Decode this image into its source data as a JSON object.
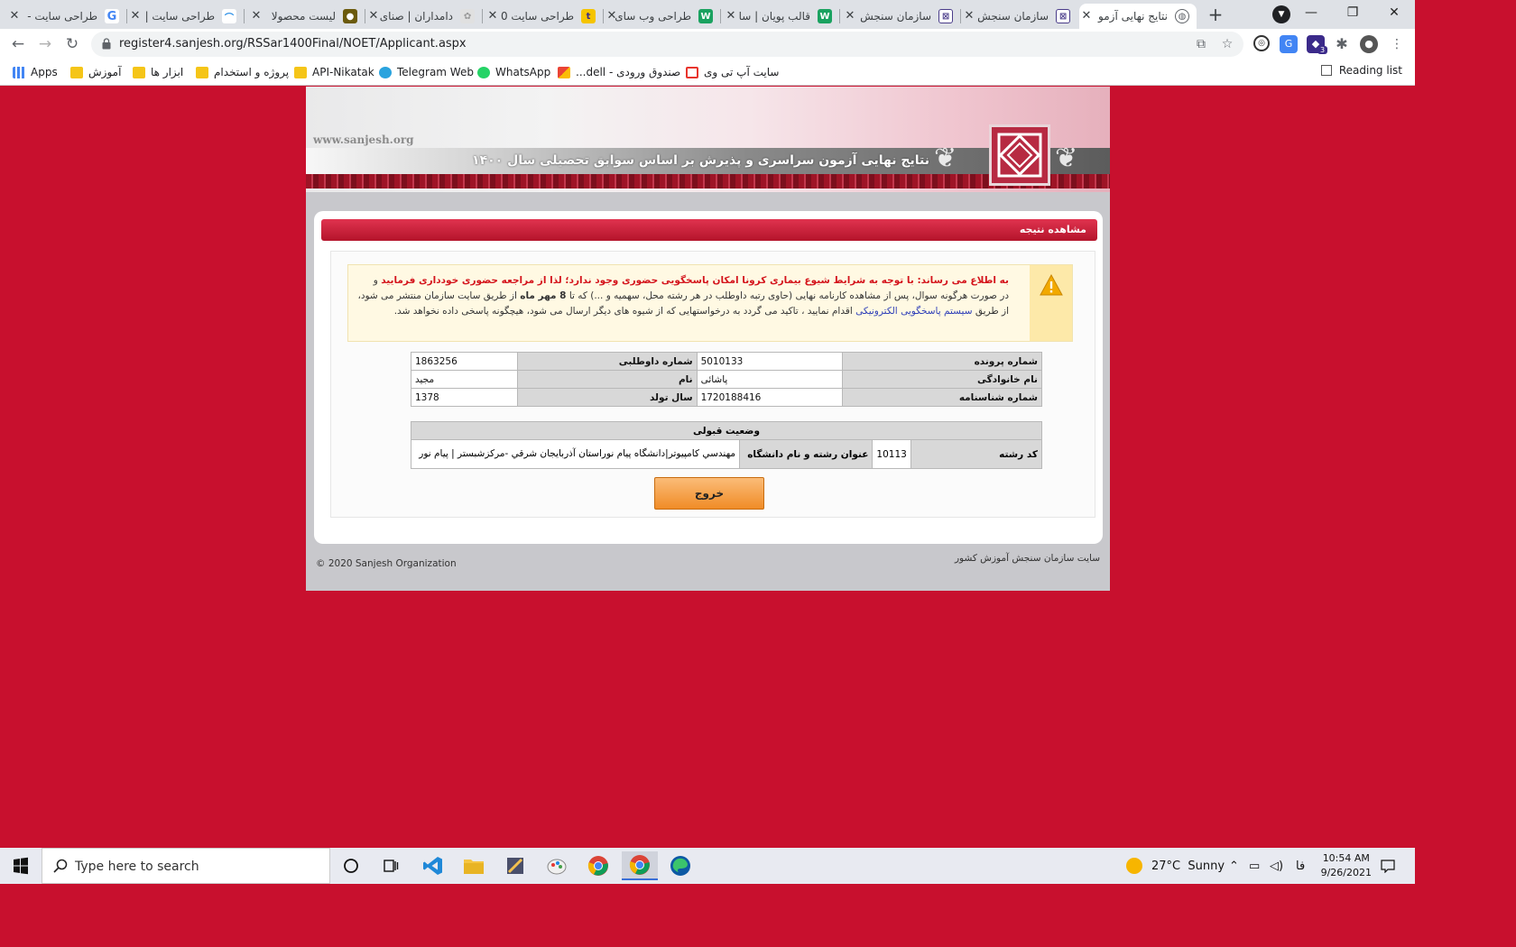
{
  "browser": {
    "tabs": [
      {
        "title": "طراحی سایت -",
        "active": false
      },
      {
        "title": "طراحی سایت |",
        "active": false
      },
      {
        "title": "لیست محصولا",
        "active": false
      },
      {
        "title": "دامداران | صنای",
        "active": false
      },
      {
        "title": "طراحی سایت 0",
        "active": false
      },
      {
        "title": "طراحی وب سای",
        "active": false
      },
      {
        "title": "قالب پویان | سا",
        "active": false
      },
      {
        "title": "سازمان سنجش",
        "active": false
      },
      {
        "title": "سازمان سنجش",
        "active": false
      },
      {
        "title": "نتایج نهایی آزمو",
        "active": true
      }
    ],
    "new_tab": "+",
    "window_controls": {
      "minimize": "—",
      "maximize": "❐",
      "close": "✕"
    },
    "url": "register4.sanjesh.org/RSSar1400Final/NOET/Applicant.aspx",
    "bookmarks": [
      {
        "label": "Apps",
        "icon": "apps-grid-icon"
      },
      {
        "label": "آموزش",
        "icon": "folder-icon"
      },
      {
        "label": "ابزار ها",
        "icon": "folder-icon"
      },
      {
        "label": "پروژه و استخدام",
        "icon": "folder-icon"
      },
      {
        "label": "API-Nikatak",
        "icon": "folder-icon"
      },
      {
        "label": "Telegram Web",
        "icon": "telegram-icon"
      },
      {
        "label": "WhatsApp",
        "icon": "whatsapp-icon"
      },
      {
        "label": "صندوق ورودی - dell...",
        "icon": "gmail-icon"
      },
      {
        "label": "سایت آپ تی وی",
        "icon": "aparat-icon"
      }
    ],
    "reading_list": "Reading list",
    "extension_badge": "3"
  },
  "page": {
    "banner_url": "www.sanjesh.org",
    "banner_title": "نتایج نهایی آزمون سراسری و پذیرش بر اساس سوابق تحصیلی سال ۱۴۰۰",
    "panel_title": "مشاهده نتیجه",
    "notice": {
      "lead": "به اطلاع می رساند: با توجه به شرایط شیوع بیماری کرونا امکان پاسخگویی حضوری وجود ندارد؛ لذا از مراجعه حضوری خودداری فرمایید",
      "and": " و",
      "body_1": "در صورت هرگونه سوال، پس از مشاهده کارنامه نهایی (حاوی رتبه داوطلب در هر رشته محل، سهمیه و ...) که تا",
      "deadline": "8 مهر ماه",
      "body_2": "از طریق سایت سازمان منتشر می شود، از طریق",
      "link": "سیستم پاسخگویی الکترونیکی",
      "body_3": "اقدام نمایید ، تاکید می گردد به درخواستهایی که از شیوه های دیگر ارسال می شود، هیچگونه پاسخی داده نخواهد شد."
    },
    "applicant": {
      "file_no_label": "شماره پرونده",
      "file_no": "5010133",
      "candidate_no_label": "شماره داوطلبی",
      "candidate_no": "1863256",
      "family_label": "نام خانوادگی",
      "family": "پاشائی",
      "name_label": "نام",
      "name": "مجید",
      "id_label": "شماره شناسنامه",
      "id": "1720188416",
      "birth_label": "سال تولد",
      "birth": "1378"
    },
    "acceptance": {
      "header": "وضعیت قبولی",
      "code_label": "کد رشته",
      "code": "10113",
      "field_label": "عنوان رشته و نام دانشگاه",
      "field": "مهندسي كامپيوتر|دانشگاه پيام نوراستان آذربايجان شرقي -مرکزشبستر | پيام نور"
    },
    "exit_button": "خروج",
    "footer_right": "سایت سازمان سنجش آموزش کشور",
    "footer_left": "© 2020 Sanjesh Organization"
  },
  "taskbar": {
    "search_placeholder": "Type here to search",
    "weather": "27°C  Sunny",
    "lang": "فا",
    "time": "10:54 AM",
    "date": "9/26/2021"
  }
}
